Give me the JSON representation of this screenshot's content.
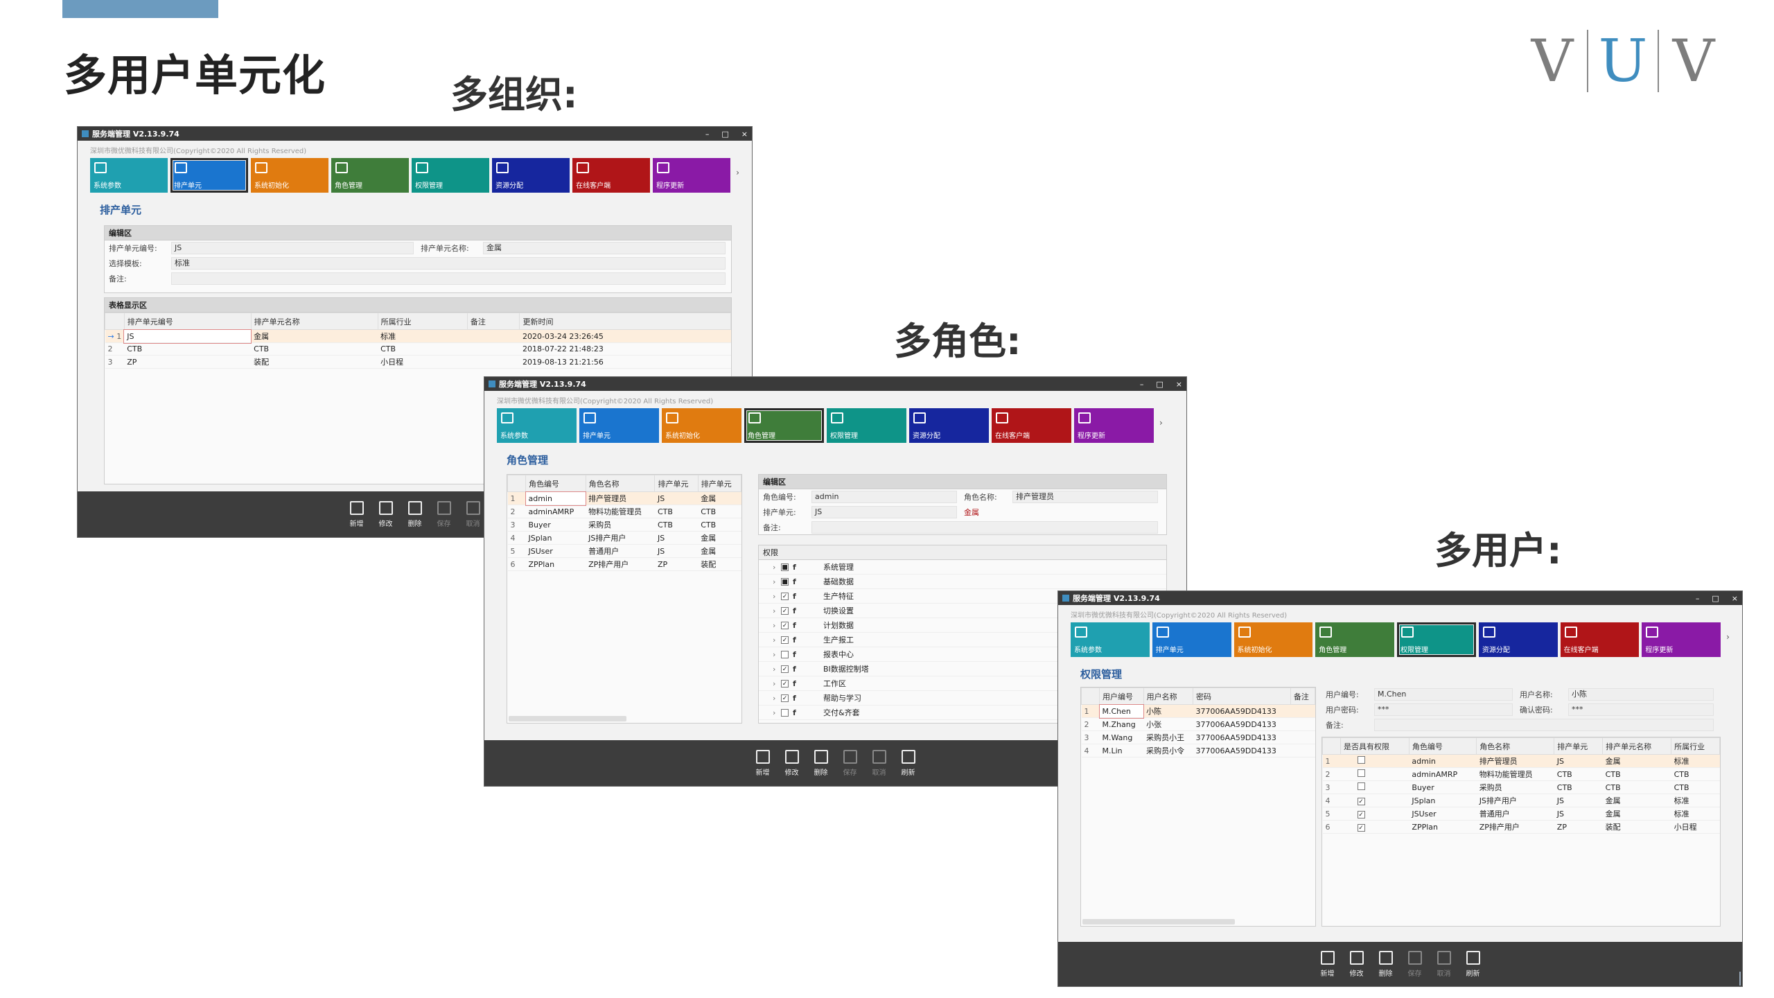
{
  "page": {
    "main_title": "多用户单元化",
    "multi_org_title": "多组织:",
    "multi_role_title": "多角色:",
    "multi_user_title": "多用户:",
    "logo_letters": [
      "V",
      "U",
      "V"
    ]
  },
  "common": {
    "window_title": "服务端管理 V2.13.9.74",
    "company": "深圳市微优微科技有限公司(Copyright©2020 All Rights Reserved)",
    "window_controls": [
      "–",
      "□",
      "×"
    ],
    "more_arrow": "›",
    "tiles": [
      {
        "label": "系统参数",
        "color": "#1fa0b0",
        "icon": "search-settings-icon"
      },
      {
        "label": "排产单元",
        "color": "#1a75cf",
        "icon": "grid-icon"
      },
      {
        "label": "系统初始化",
        "color": "#e07b10",
        "icon": "init-icon"
      },
      {
        "label": "角色管理",
        "color": "#3f7d3a",
        "icon": "role-icon"
      },
      {
        "label": "权限管理",
        "color": "#0e9488",
        "icon": "permission-icon"
      },
      {
        "label": "资源分配",
        "color": "#16269e",
        "icon": "resource-icon"
      },
      {
        "label": "在线客户端",
        "color": "#b01518",
        "icon": "client-icon"
      },
      {
        "label": "程序更新",
        "color": "#8a1aa6",
        "icon": "update-icon"
      }
    ],
    "footer_buttons": [
      {
        "label": "新增",
        "disabled": false
      },
      {
        "label": "修改",
        "disabled": false
      },
      {
        "label": "删除",
        "disabled": false
      },
      {
        "label": "保存",
        "disabled": true
      },
      {
        "label": "取消",
        "disabled": true
      },
      {
        "label": "刷新",
        "disabled": false
      }
    ]
  },
  "win1": {
    "heading": "排产单元",
    "edit_area": "编辑区",
    "f_code_label": "排产单元编号:",
    "f_code_value": "JS",
    "f_name_label": "排产单元名称:",
    "f_name_value": "金属",
    "f_template_label": "选择模板:",
    "f_template_value": "标准",
    "f_note_label": "备注:",
    "table_area": "表格显示区",
    "columns": [
      "排产单元编号",
      "排产单元名称",
      "所属行业",
      "备注",
      "更新时间"
    ],
    "rows": [
      {
        "no": "1",
        "code": "JS",
        "name": "金属",
        "industry": "标准",
        "note": "",
        "time": "2020-03-24 23:26:45"
      },
      {
        "no": "2",
        "code": "CTB",
        "name": "CTB",
        "industry": "CTB",
        "note": "",
        "time": "2018-07-22 21:48:23"
      },
      {
        "no": "3",
        "code": "ZP",
        "name": "装配",
        "industry": "小日程",
        "note": "",
        "time": "2019-08-13 21:21:56"
      }
    ]
  },
  "win2": {
    "heading": "角色管理",
    "columns": [
      "角色编号",
      "角色名称",
      "排产单元",
      "排产单元"
    ],
    "rows": [
      {
        "no": "1",
        "code": "admin",
        "name": "排产管理员",
        "unit": "JS",
        "unit_name": "金属"
      },
      {
        "no": "2",
        "code": "adminAMRP",
        "name": "物料功能管理员",
        "unit": "CTB",
        "unit_name": "CTB"
      },
      {
        "no": "3",
        "code": "Buyer",
        "name": "采购员",
        "unit": "CTB",
        "unit_name": "CTB"
      },
      {
        "no": "4",
        "code": "JSplan",
        "name": "JS排产用户",
        "unit": "JS",
        "unit_name": "金属"
      },
      {
        "no": "5",
        "code": "JSUser",
        "name": "普通用户",
        "unit": "JS",
        "unit_name": "金属"
      },
      {
        "no": "6",
        "code": "ZPPlan",
        "name": "ZP排产用户",
        "unit": "ZP",
        "unit_name": "装配"
      }
    ],
    "edit_area": "编辑区",
    "f_code_label": "角色编号:",
    "f_code_value": "admin",
    "f_name_label": "角色名称:",
    "f_name_value": "排产管理员",
    "f_unit_label": "排产单元:",
    "f_unit_value": "JS",
    "f_unit_name": "金属",
    "f_note_label": "备注:",
    "perm_title": "权限",
    "perms": [
      {
        "label": "系统管理",
        "checked": "■"
      },
      {
        "label": "基础数据",
        "checked": "■"
      },
      {
        "label": "生产特征",
        "checked": "✓"
      },
      {
        "label": "切换设置",
        "checked": "✓"
      },
      {
        "label": "计划数据",
        "checked": "✓"
      },
      {
        "label": "生产报工",
        "checked": "✓"
      },
      {
        "label": "报表中心",
        "checked": ""
      },
      {
        "label": "BI数据控制塔",
        "checked": "✓"
      },
      {
        "label": "工作区",
        "checked": "✓"
      },
      {
        "label": "帮助与学习",
        "checked": "✓"
      },
      {
        "label": "交付&齐套",
        "checked": ""
      }
    ]
  },
  "win3": {
    "heading": "权限管理",
    "user_columns": [
      "用户编号",
      "用户名称",
      "密码",
      "备注"
    ],
    "users": [
      {
        "no": "1",
        "code": "M.Chen",
        "name": "小陈",
        "pwd": "377006AA59DD4133"
      },
      {
        "no": "2",
        "code": "M.Zhang",
        "name": "小张",
        "pwd": "377006AA59DD4133"
      },
      {
        "no": "3",
        "code": "M.Wang",
        "name": "采购员小王",
        "pwd": "377006AA59DD4133"
      },
      {
        "no": "4",
        "code": "M.Lin",
        "name": "采购员小令",
        "pwd": "377006AA59DD4133"
      }
    ],
    "f_code_label": "用户编号:",
    "f_code_value": "M.Chen",
    "f_name_label": "用户名称:",
    "f_name_value": "小陈",
    "f_pwd_label": "用户密码:",
    "f_pwd_value": "***",
    "f_confirm_label": "确认密码:",
    "f_confirm_value": "***",
    "f_note_label": "备注:",
    "role_columns": [
      "是否具有权限",
      "角色编号",
      "角色名称",
      "排产单元",
      "排产单元名称",
      "所属行业"
    ],
    "roles": [
      {
        "no": "1",
        "has": "",
        "code": "admin",
        "name": "排产管理员",
        "unit": "JS",
        "unit_name": "金属",
        "industry": "标准"
      },
      {
        "no": "2",
        "has": "",
        "code": "adminAMRP",
        "name": "物料功能管理员",
        "unit": "CTB",
        "unit_name": "CTB",
        "industry": "CTB"
      },
      {
        "no": "3",
        "has": "",
        "code": "Buyer",
        "name": "采购员",
        "unit": "CTB",
        "unit_name": "CTB",
        "industry": "CTB"
      },
      {
        "no": "4",
        "has": "✓",
        "code": "JSplan",
        "name": "JS排产用户",
        "unit": "JS",
        "unit_name": "金属",
        "industry": "标准"
      },
      {
        "no": "5",
        "has": "✓",
        "code": "JSUser",
        "name": "普通用户",
        "unit": "JS",
        "unit_name": "金属",
        "industry": "标准"
      },
      {
        "no": "6",
        "has": "✓",
        "code": "ZPPlan",
        "name": "ZP排产用户",
        "unit": "ZP",
        "unit_name": "装配",
        "industry": "小日程"
      }
    ]
  }
}
